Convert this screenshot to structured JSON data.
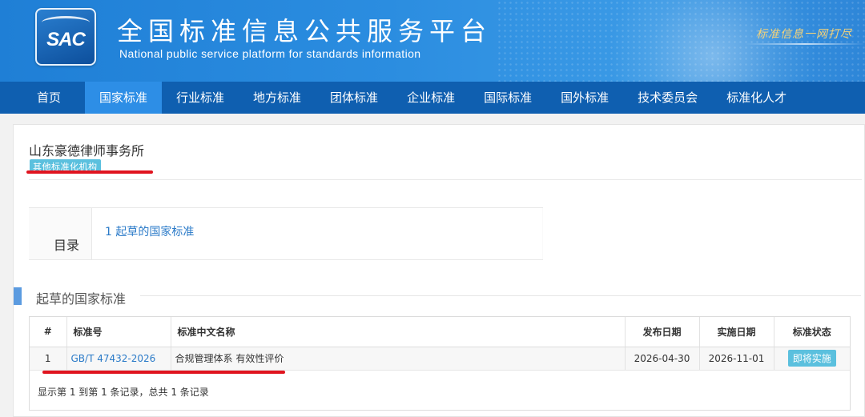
{
  "header": {
    "logo_text": "SAC",
    "title": "全国标准信息公共服务平台",
    "subtitle": "National public service platform  for standards information",
    "slogan": "标准信息一网打尽"
  },
  "nav": {
    "items": [
      {
        "label": "首页"
      },
      {
        "label": "国家标准"
      },
      {
        "label": "行业标准"
      },
      {
        "label": "地方标准"
      },
      {
        "label": "团体标准"
      },
      {
        "label": "企业标准"
      },
      {
        "label": "国际标准"
      },
      {
        "label": "国外标准"
      },
      {
        "label": "技术委员会"
      },
      {
        "label": "标准化人才"
      }
    ],
    "active": "国家标准"
  },
  "org": {
    "name": "山东豪德律师事务所",
    "tag": "其他标准化机构"
  },
  "toc": {
    "label": "目录",
    "items": [
      {
        "label": "1  起草的国家标准"
      }
    ]
  },
  "section": {
    "title": "起草的国家标准"
  },
  "table": {
    "headers": [
      "#",
      "标准号",
      "标准中文名称",
      "发布日期",
      "实施日期",
      "标准状态"
    ],
    "rows": [
      {
        "index": "1",
        "code": "GB/T 47432-2026",
        "name": "合规管理体系 有效性评价",
        "publish_date": "2026-04-30",
        "effective_date": "2026-11-01",
        "status": "即将实施"
      }
    ],
    "summary": "显示第 1 到第 1 条记录，总共 1 条记录"
  },
  "colors": {
    "banner": "#2b8de0",
    "nav": "#0f5fb0",
    "nav_active": "#2d8ee6",
    "tag": "#5bc0de",
    "link": "#2a7ac8",
    "annotation_red": "#e0141f"
  }
}
